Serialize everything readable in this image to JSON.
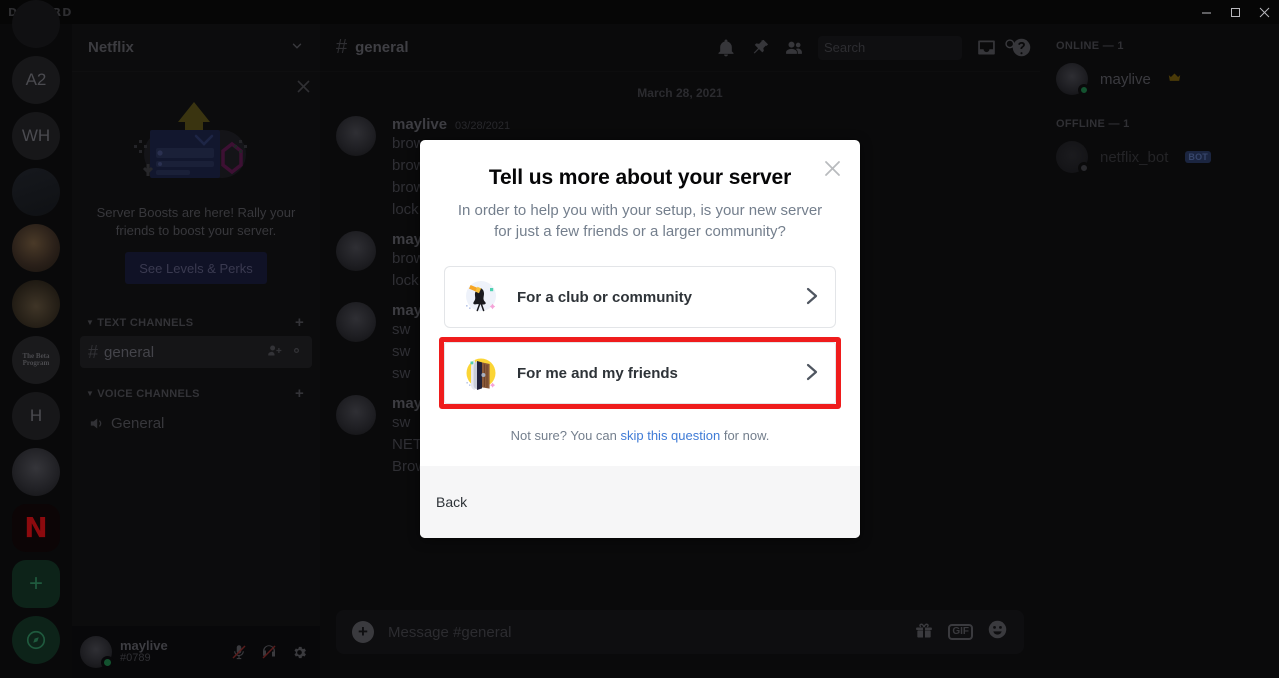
{
  "titlebar": {
    "logo": "DISCORD",
    "minimize": "minimize-icon",
    "maximize": "maximize-icon",
    "close": "close-icon"
  },
  "guild_rail": {
    "items": [
      {
        "label": "",
        "kind": "home",
        "name": "guild-home"
      },
      {
        "label": "A2",
        "kind": "text",
        "name": "guild-a2"
      },
      {
        "label": "WH",
        "kind": "text",
        "name": "guild-wh"
      },
      {
        "label": "",
        "kind": "notes",
        "name": "guild-notes"
      },
      {
        "label": "",
        "kind": "dog1",
        "name": "guild-dog-1"
      },
      {
        "label": "",
        "kind": "dog2",
        "name": "guild-dog-2"
      },
      {
        "label": "The Beta Program",
        "kind": "beta",
        "name": "guild-beta-program"
      },
      {
        "label": "H",
        "kind": "text",
        "name": "guild-h"
      },
      {
        "label": "",
        "kind": "avatar",
        "name": "guild-avatar"
      },
      {
        "label": "N",
        "kind": "netflix",
        "name": "guild-netflix",
        "selected": true
      },
      {
        "label": "+",
        "kind": "add",
        "name": "add-a-server-button"
      },
      {
        "label": "",
        "kind": "explore",
        "name": "explore-servers-button"
      }
    ]
  },
  "sidebar": {
    "server_name": "Netflix",
    "boost": {
      "text": "Server Boosts are here! Rally your friends to boost your server.",
      "button": "See Levels & Perks"
    },
    "categories": [
      {
        "label": "TEXT CHANNELS",
        "channels": [
          {
            "name": "general",
            "type": "text",
            "active": true
          }
        ]
      },
      {
        "label": "VOICE CHANNELS",
        "channels": [
          {
            "name": "General",
            "type": "voice",
            "active": false
          }
        ]
      }
    ],
    "user": {
      "name": "maylive",
      "tag": "#0789",
      "mute_icon": "microphone-muted-icon",
      "deafen_icon": "headphones-deafened-icon",
      "settings_icon": "gear-icon"
    }
  },
  "chat": {
    "channel": "general",
    "header_icons": [
      "bell-icon",
      "pin-icon",
      "members-icon",
      "inbox-icon",
      "help-icon"
    ],
    "search": {
      "placeholder": "Search",
      "value": ""
    },
    "date_divider": "March 28, 2021",
    "messages": [
      {
        "author": "maylive",
        "time": "03/28/2021",
        "lines": [
          "brow",
          "brow",
          "brow",
          "lock"
        ]
      },
      {
        "author": "maylive",
        "time": "",
        "lines": [
          "brow",
          "lock"
        ]
      },
      {
        "author": "maylive",
        "time": "",
        "lines": [
          "sw",
          "sw",
          "sw"
        ]
      },
      {
        "author": "maylive",
        "time": "",
        "lines": [
          "sw",
          "NETFLIX",
          "Browse google"
        ]
      }
    ],
    "composer": {
      "placeholder": "Message #general",
      "plus_icon": "add-attachment-icon",
      "gift_icon": "gift-icon",
      "gif_label": "GIF",
      "emoji_icon": "emoji-icon"
    }
  },
  "members": {
    "online_label": "ONLINE — 1",
    "offline_label": "OFFLINE — 1",
    "online": [
      {
        "name": "maylive",
        "badge": "crown-icon"
      }
    ],
    "offline": [
      {
        "name": "netflix_bot",
        "badge": "BOT"
      }
    ]
  },
  "modal": {
    "title": "Tell us more about your server",
    "subtitle": "In order to help you with your setup, is your new server for just a few friends or a larger community?",
    "close_icon": "close-icon",
    "options": [
      {
        "label": "For a club or community",
        "icon": "megaphone-person-icon",
        "highlighted": false
      },
      {
        "label": "For me and my friends",
        "icon": "open-door-icon",
        "highlighted": true
      }
    ],
    "footnote_prefix": "Not sure? You can ",
    "footnote_link": "skip this question",
    "footnote_suffix": " for now.",
    "back_label": "Back",
    "highlight_color": "#ef1c1c"
  }
}
